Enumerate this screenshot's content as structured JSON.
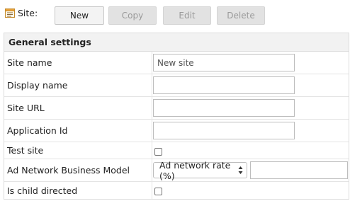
{
  "toolbar": {
    "site_label": "Site:",
    "new_label": "New",
    "copy_label": "Copy",
    "edit_label": "Edit",
    "delete_label": "Delete"
  },
  "panel": {
    "header": "General settings",
    "fields": {
      "site_name": {
        "label": "Site name",
        "value": "",
        "placeholder": "New site"
      },
      "display_name": {
        "label": "Display name",
        "value": ""
      },
      "site_url": {
        "label": "Site URL",
        "value": ""
      },
      "application_id": {
        "label": "Application Id",
        "value": ""
      },
      "test_site": {
        "label": "Test site",
        "checked": false
      },
      "business_model": {
        "label": "Ad Network Business Model",
        "selected": "Ad network rate (%)",
        "rate_value": ""
      },
      "child_directed": {
        "label": "Is child directed",
        "checked": false
      }
    }
  },
  "icons": {
    "site": "list-window-icon",
    "select_arrows": "up-down-arrows-icon"
  },
  "colors": {
    "icon_accent": "#e8a13a",
    "disabled_button_bg": "#e2e2e2",
    "header_bg": "#f2f2f2"
  }
}
